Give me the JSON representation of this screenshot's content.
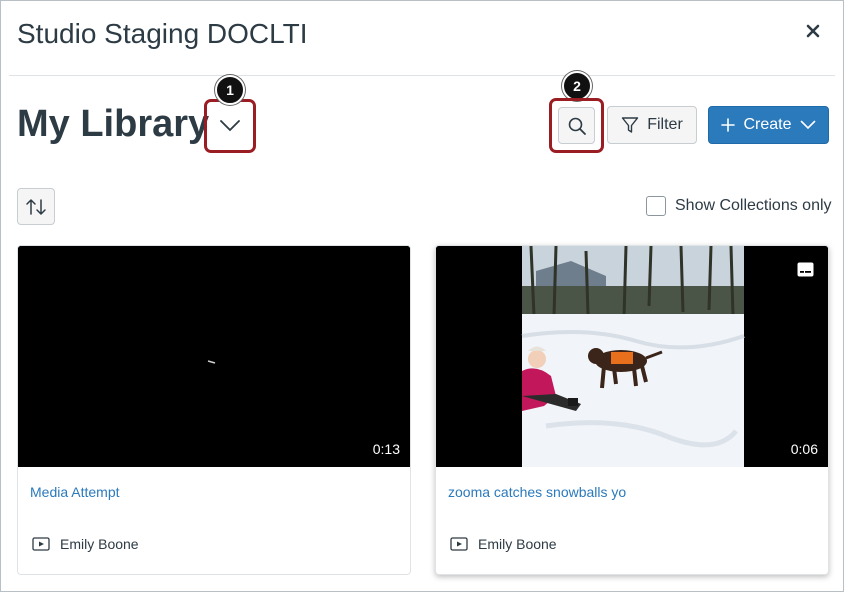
{
  "modal": {
    "title": "Studio Staging DOCLTI"
  },
  "library": {
    "title": "My Library"
  },
  "callouts": [
    "1",
    "2"
  ],
  "toolbar": {
    "filter_label": "Filter",
    "create_label": "Create"
  },
  "collections": {
    "label": "Show Collections only",
    "checked": false
  },
  "media": [
    {
      "title": "Media Attempt",
      "duration": "0:13",
      "owner": "Emily Boone"
    },
    {
      "title": "zooma catches snowballs yo",
      "duration": "0:06",
      "owner": "Emily Boone"
    }
  ],
  "colors": {
    "accent": "#2b7abc",
    "callout_ring": "#9b1d24",
    "text": "#2d3b45"
  }
}
